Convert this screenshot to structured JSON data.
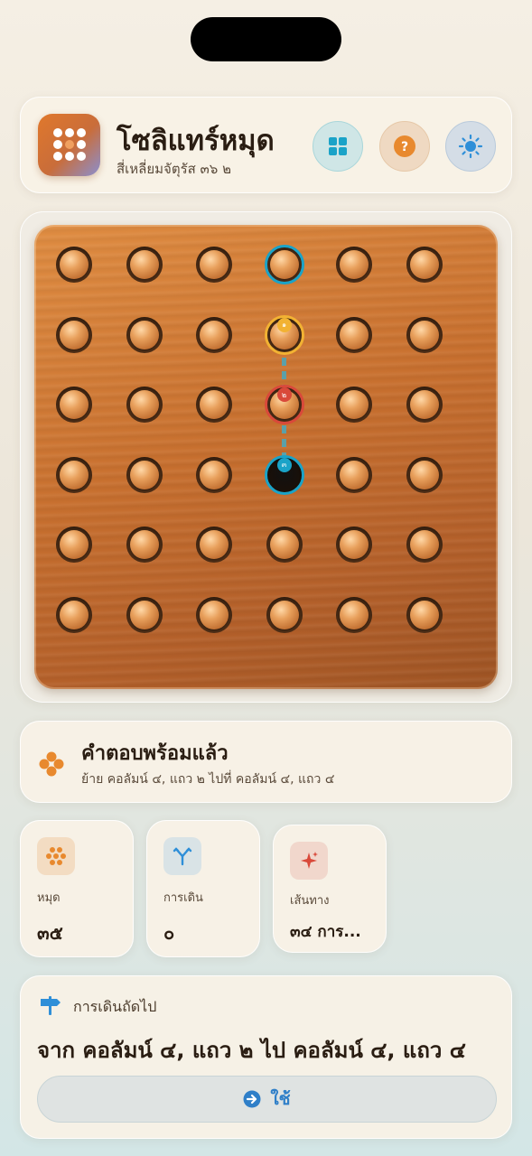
{
  "app": {
    "title": "โซลิแทร์หมุด",
    "subtitle": "สี่เหลี่ยมจัตุรัส ๓๖ ๒",
    "icons": {
      "app": "peg-grid-icon",
      "layout": "grid-icon",
      "help": "help-icon",
      "theme": "sun-icon"
    },
    "colors": {
      "accent": "#e0782c",
      "cyan": "#1aa3c8",
      "yellow": "#f2b233",
      "red": "#d9493a",
      "blue": "#2f7fc8"
    }
  },
  "board": {
    "rows": 6,
    "cols": 6,
    "empty_cells": [
      [
        3,
        3
      ]
    ],
    "selected_cell": [
      0,
      3
    ],
    "hint_path": {
      "from": [
        1,
        3
      ],
      "over": [
        2,
        3
      ],
      "to": [
        3,
        3
      ]
    },
    "markers": {
      "from": "๑",
      "over": "๒",
      "to": "๓"
    }
  },
  "hint": {
    "title": "คำตอบพร้อมแล้ว",
    "detail": "ย้าย คอลัมน์ ๔, แถว ๒ ไปที่ คอลัมน์ ๔, แถว ๔",
    "icon": "pegs-icon"
  },
  "stats": [
    {
      "label": "หมุด",
      "value": "๓๕",
      "icon": "pegs-icon",
      "bg": "#f3dcc2"
    },
    {
      "label": "การเดิน",
      "value": "๐",
      "icon": "branch-icon",
      "bg": "#d9e3e6"
    },
    {
      "label": "เส้นทาง",
      "value": "๓๔ การ...",
      "icon": "sparkle-icon",
      "bg": "#f1d7cc"
    }
  ],
  "next": {
    "label": "การเดินถัดไป",
    "move": "จาก คอลัมน์ ๔, แถว ๒ ไป คอลัมน์ ๔, แถว ๔",
    "apply_label": "ใช้"
  }
}
